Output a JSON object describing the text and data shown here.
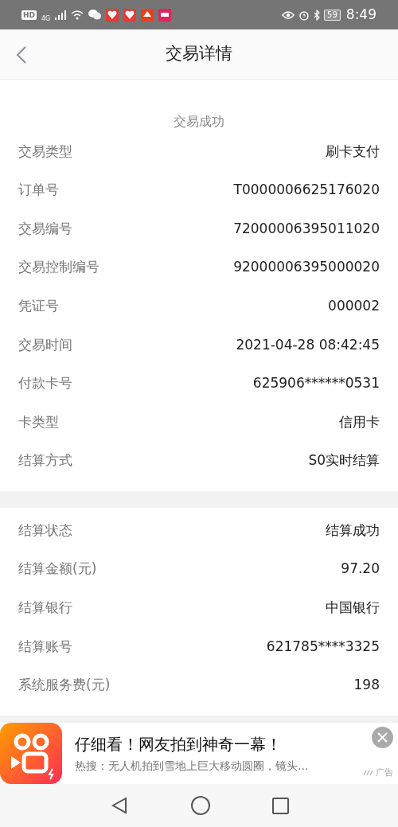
{
  "status_bar": {
    "hd": "HD",
    "network": "4G",
    "battery": "59",
    "time": "8:49"
  },
  "header": {
    "title": "交易详情"
  },
  "result": {
    "status": "交易成功"
  },
  "groups": [
    {
      "rows": [
        {
          "label": "交易类型",
          "value": "刷卡支付"
        },
        {
          "label": "订单号",
          "value": "T0000006625176020"
        },
        {
          "label": "交易编号",
          "value": "72000006395011020"
        },
        {
          "label": "交易控制编号",
          "value": "92000006395000020"
        },
        {
          "label": "凭证号",
          "value": "000002"
        },
        {
          "label": "交易时间",
          "value": "2021-04-28 08:42:45"
        },
        {
          "label": "付款卡号",
          "value": "625906******0531"
        },
        {
          "label": "卡类型",
          "value": "信用卡"
        },
        {
          "label": "结算方式",
          "value": "S0实时结算"
        }
      ]
    },
    {
      "rows": [
        {
          "label": "结算状态",
          "value": "结算成功"
        },
        {
          "label": "结算金额(元)",
          "value": "97.20"
        },
        {
          "label": "结算银行",
          "value": "中国银行"
        },
        {
          "label": "结算账号",
          "value": "621785****3325"
        },
        {
          "label": "系统服务费(元)",
          "value": "198"
        }
      ]
    }
  ],
  "ad": {
    "title": "仔细看！网友拍到神奇一幕！",
    "subtitle": "热搜：无人机拍到雪地上巨大移动圆圈，镜头...",
    "tag": "广告"
  }
}
